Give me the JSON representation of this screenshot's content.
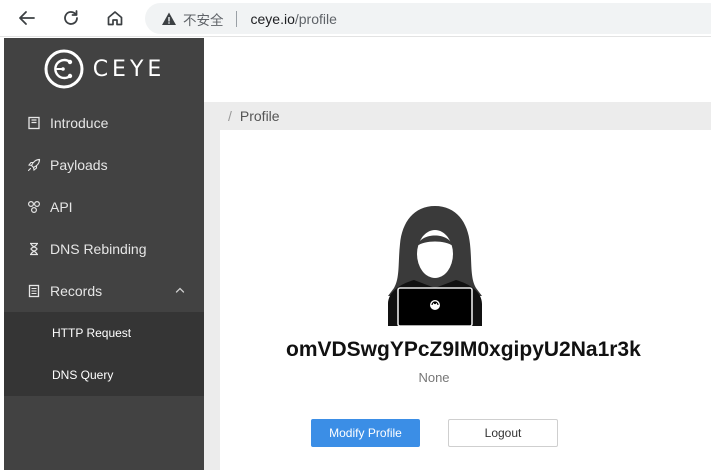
{
  "browser": {
    "security_label": "不安全",
    "url_host": "ceye.io",
    "url_path": "/profile",
    "icons": {
      "back": "back-arrow-icon",
      "reload": "reload-icon",
      "home": "home-icon",
      "warning": "warning-triangle-icon"
    }
  },
  "sidebar": {
    "logo_text": "CEYE",
    "items": [
      {
        "label": "Introduce",
        "icon": "book-icon"
      },
      {
        "label": "Payloads",
        "icon": "rocket-icon"
      },
      {
        "label": "API",
        "icon": "molecule-icon"
      },
      {
        "label": "DNS Rebinding",
        "icon": "hourglass-icon"
      },
      {
        "label": "Records",
        "icon": "document-icon"
      }
    ],
    "records_submenu": [
      {
        "label": "HTTP Request"
      },
      {
        "label": "DNS Query"
      }
    ]
  },
  "breadcrumb": {
    "current": "Profile"
  },
  "profile": {
    "username": "omVDSwgYPcZ9IM0xgipyU2Na1r3k",
    "subtitle": "None",
    "modify_label": "Modify Profile",
    "logout_label": "Logout"
  },
  "colors": {
    "sidebar_bg": "#424242",
    "submenu_bg": "#353535",
    "primary_button": "#3b8ee6",
    "breadcrumb_bg": "#ececec"
  }
}
